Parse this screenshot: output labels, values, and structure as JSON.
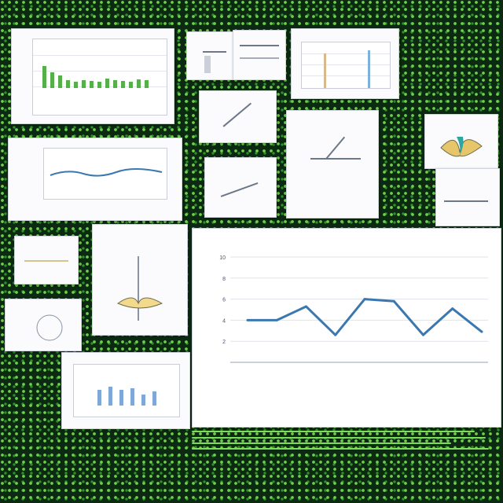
{
  "scene": {
    "background_color": "#0c2a12",
    "dot_colors": [
      "#6fcf4a",
      "#2f8f2a"
    ],
    "grass_color": "#7ddc5a"
  },
  "chart_data": {
    "type": "line",
    "title": "",
    "xlabel": "",
    "ylabel": "",
    "categories": [
      "",
      "",
      "",
      "",
      "",
      "",
      "",
      "",
      "",
      ""
    ],
    "values": [
      4.0,
      4.0,
      5.3,
      2.6,
      6.0,
      5.8,
      2.6,
      5.1,
      2.9
    ],
    "ylim": [
      0,
      10
    ],
    "y_ticks": [
      2,
      4,
      6,
      8,
      10
    ],
    "grid": true,
    "line_color": "#3b78b0"
  }
}
